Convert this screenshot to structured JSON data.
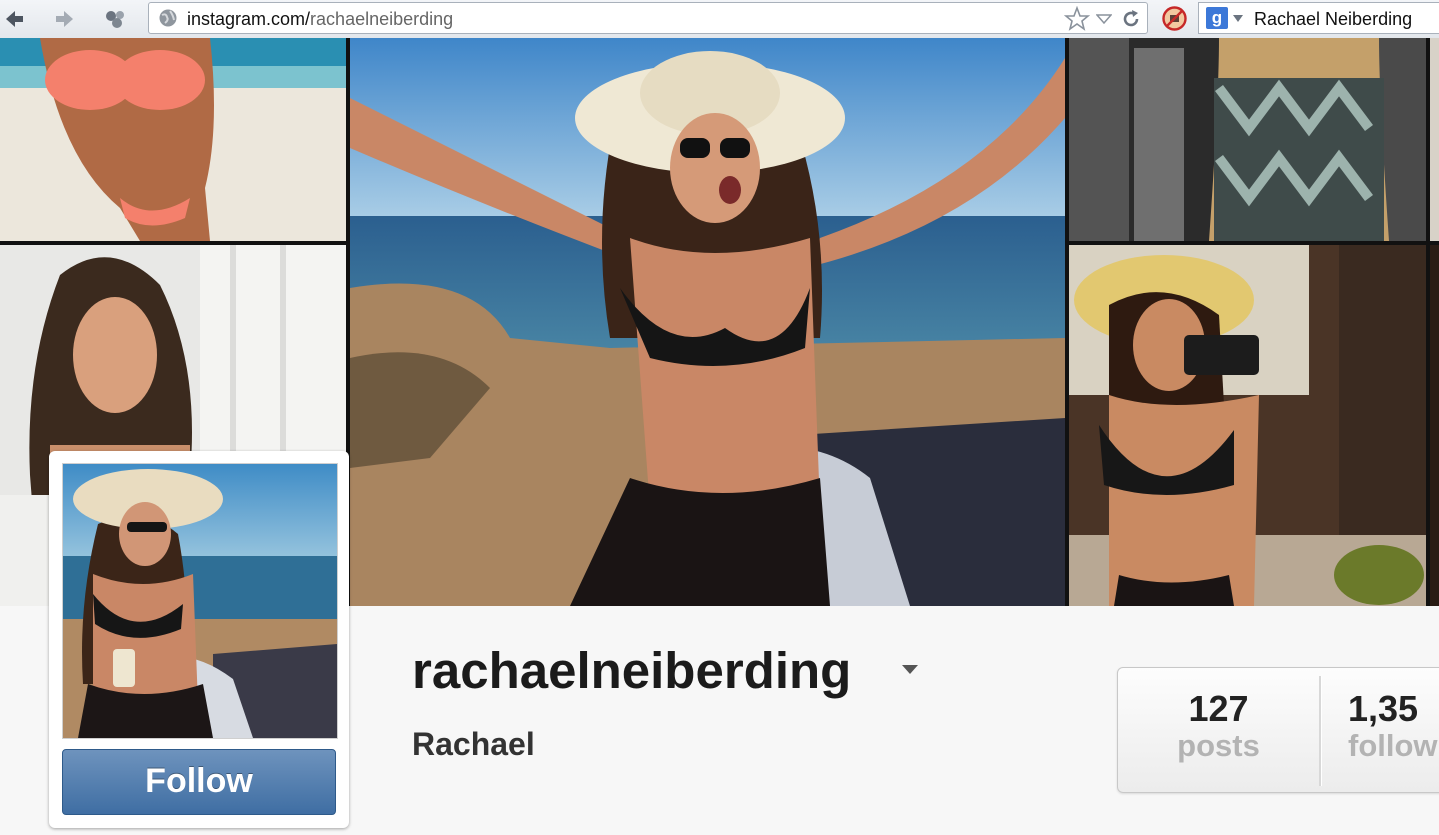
{
  "browser": {
    "url_domain": "instagram.com/",
    "url_path": "rachaelneiberding",
    "search_query": "Rachael Neiberding",
    "back_icon": "back-arrow-icon",
    "forward_icon": "forward-arrow-icon"
  },
  "profile": {
    "username": "rachaelneiberding",
    "full_name": "Rachael",
    "follow_label": "Follow",
    "stats": [
      {
        "number": "127",
        "label": "posts"
      },
      {
        "number": "1,35",
        "label": "follow"
      }
    ]
  },
  "colors": {
    "follow_button": "#4a77a8",
    "page_background": "#f7f7f7"
  }
}
